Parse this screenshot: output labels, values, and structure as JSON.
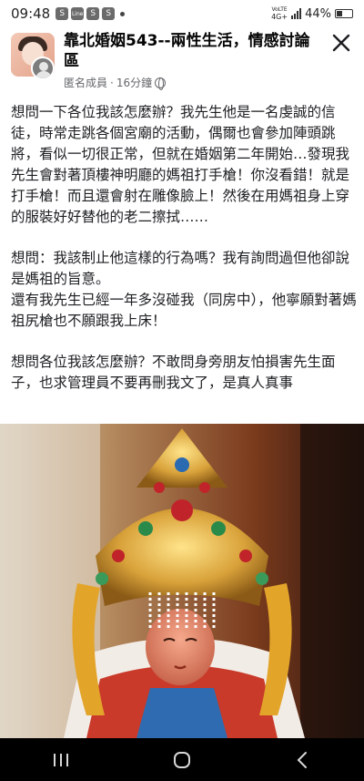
{
  "status_bar": {
    "time": "09:48",
    "apps": [
      "S",
      "Line",
      "S",
      "S"
    ],
    "network_top": "VoLTE",
    "network_type": "4G+",
    "battery": "44%"
  },
  "post": {
    "group_name": "靠北婚姻543--兩性生活，情感討論區",
    "author": "匿名成員",
    "separator": "·",
    "time_ago": "16分鐘",
    "paragraphs": [
      "想問一下各位我該怎麼辦？我先生他是一名虔誠的信徒，時常走跳各個宮廟的活動，偶爾也會參加陣頭跳將，看似一切很正常，但就在婚姻第二年開始…發現我先生會對著頂樓神明廳的媽祖打手槍！你沒看錯！就是打手槍！而且還會射在雕像臉上！然後在用媽祖身上穿的服裝好好替他的老二擦拭……",
      "想問：我該制止他這樣的行為嗎？我有詢問過但他卻說是媽祖的旨意。",
      "還有我先生已經一年多沒碰我（同房中），他寧願對著媽祖尻槍也不願跟我上床！",
      "想問各位我該怎麼辦？不敢問身旁朋友怕損害先生面子，也求管理員不要再刪我文了，是真人真事"
    ]
  },
  "icons": {
    "close": "close-icon",
    "globe": "globe-icon",
    "recent_apps": "recent-apps-icon",
    "home": "home-icon",
    "back": "back-icon"
  },
  "colors": {
    "title": "#050505",
    "meta": "#65676b",
    "nav_bar": "#000000"
  }
}
